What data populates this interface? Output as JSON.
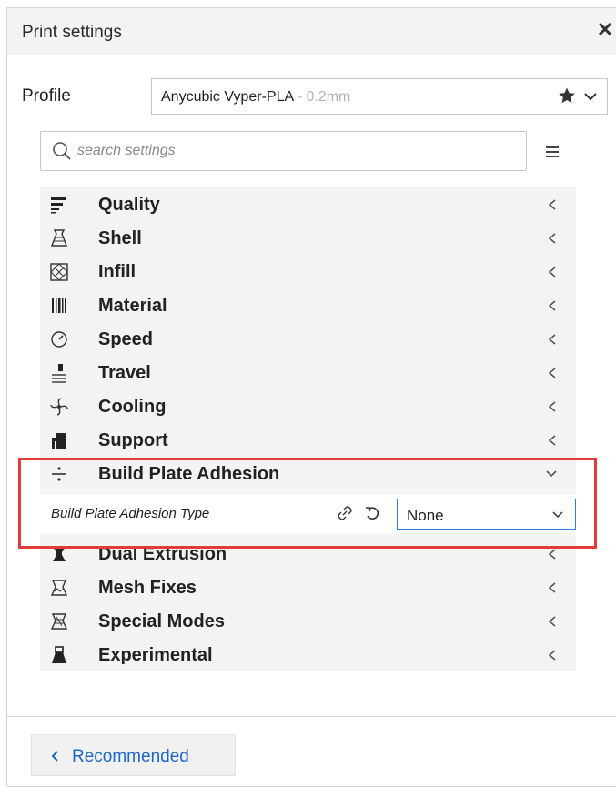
{
  "window": {
    "title": "Print settings",
    "close_glyph": "✕"
  },
  "profile": {
    "label": "Profile",
    "name": "Anycubic Vyper-PLA",
    "variant": " - 0.2mm",
    "favorite_icon": "star-icon",
    "dropdown_icon": "chevron-down-icon"
  },
  "search": {
    "placeholder": "search settings",
    "icon": "search-icon",
    "menu_icon": "hamburger-menu-icon"
  },
  "categories": [
    {
      "label": "Quality",
      "icon": "quality-icon",
      "expanded": false
    },
    {
      "label": "Shell",
      "icon": "shell-icon",
      "expanded": false
    },
    {
      "label": "Infill",
      "icon": "infill-icon",
      "expanded": false
    },
    {
      "label": "Material",
      "icon": "material-icon",
      "expanded": false
    },
    {
      "label": "Speed",
      "icon": "speed-icon",
      "expanded": false
    },
    {
      "label": "Travel",
      "icon": "travel-icon",
      "expanded": false
    },
    {
      "label": "Cooling",
      "icon": "cooling-icon",
      "expanded": false
    },
    {
      "label": "Support",
      "icon": "support-icon",
      "expanded": false
    },
    {
      "label": "Build Plate Adhesion",
      "icon": "adhesion-icon",
      "expanded": true
    },
    {
      "label": "Dual Extrusion",
      "icon": "dual-extrusion-icon",
      "expanded": false
    },
    {
      "label": "Mesh Fixes",
      "icon": "mesh-fixes-icon",
      "expanded": false
    },
    {
      "label": "Special Modes",
      "icon": "special-modes-icon",
      "expanded": false
    },
    {
      "label": "Experimental",
      "icon": "experimental-icon",
      "expanded": false
    }
  ],
  "adhesion_setting": {
    "label": "Build Plate Adhesion Type",
    "value": "None",
    "link_icon": "link-icon",
    "reset_icon": "reset-icon"
  },
  "footer": {
    "recommended_label": "Recommended"
  },
  "colors": {
    "accent": "#1e66c7",
    "highlight": "#e23b3b",
    "select_border": "#2f7ed8"
  }
}
